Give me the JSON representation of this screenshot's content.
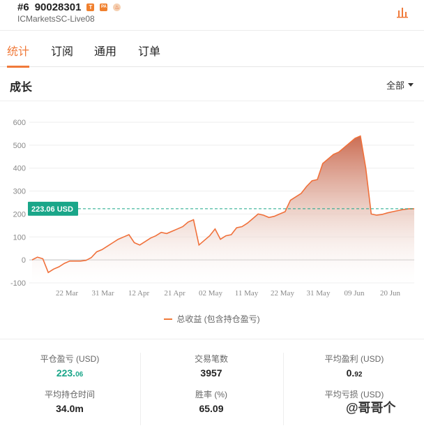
{
  "header": {
    "rank": "#6",
    "account_number": "90028301",
    "badges": [
      {
        "name": "t-badge-icon",
        "text": "T"
      },
      {
        "name": "pa-badge-icon",
        "text": "PA"
      },
      {
        "name": "fire-badge-icon",
        "text": "♨"
      }
    ],
    "server": "ICMarketsSC-Live08",
    "chart_icon": "bar-chart-icon"
  },
  "tabs": [
    {
      "label": "统计",
      "active": true
    },
    {
      "label": "订阅",
      "active": false
    },
    {
      "label": "通用",
      "active": false
    },
    {
      "label": "订单",
      "active": false
    }
  ],
  "section": {
    "title": "成长",
    "range": "全部"
  },
  "colors": {
    "accent": "#f07a3a",
    "green": "#1aa689",
    "line": "#f0703a"
  },
  "chart_data": {
    "type": "area",
    "xlabel": "",
    "ylabel": "",
    "ylim": [
      -100,
      600
    ],
    "yticks": [
      -100,
      0,
      100,
      200,
      300,
      400,
      500,
      600
    ],
    "xticks": [
      "22 Mar",
      "31 Mar",
      "12 Apr",
      "21 Apr",
      "02 May",
      "11 May",
      "22 May",
      "31 May",
      "09 Jun",
      "20 Jun"
    ],
    "current_value": 223.06,
    "current_label": "223.06 USD",
    "legend": "总收益 (包含持仓盈亏)",
    "series": [
      {
        "values": [
          0,
          12,
          5,
          -55,
          -40,
          -30,
          -15,
          -5,
          -5,
          -5,
          -2,
          10,
          35,
          45,
          60,
          75,
          90,
          100,
          110,
          75,
          65,
          80,
          95,
          105,
          120,
          115,
          125,
          135,
          145,
          165,
          175,
          65,
          85,
          105,
          135,
          90,
          105,
          110,
          140,
          145,
          160,
          180,
          200,
          195,
          185,
          190,
          200,
          210,
          260,
          275,
          290,
          320,
          345,
          350,
          420,
          440,
          460,
          470,
          490,
          510,
          530,
          540,
          400,
          200,
          195,
          198,
          205,
          210,
          215,
          220,
          223,
          223
        ]
      }
    ]
  },
  "stats": [
    {
      "label": "平仓盈亏 (USD)",
      "value_main": "223.",
      "value_small": "06",
      "green": true
    },
    {
      "label": "交易笔数",
      "value_main": "3957",
      "value_small": "",
      "green": false
    },
    {
      "label": "平均盈利 (USD)",
      "value_main": "0.",
      "value_small": "92",
      "green": false
    },
    {
      "label": "平均持仓时间",
      "value_main": "34.0m",
      "value_small": "",
      "green": false
    },
    {
      "label": "胜率 (%)",
      "value_main": "65.09",
      "value_small": "",
      "green": false
    },
    {
      "label": "平均亏损 (USD)",
      "value_main": "",
      "value_small": "",
      "green": false
    }
  ],
  "watermark": "@哥哥个"
}
